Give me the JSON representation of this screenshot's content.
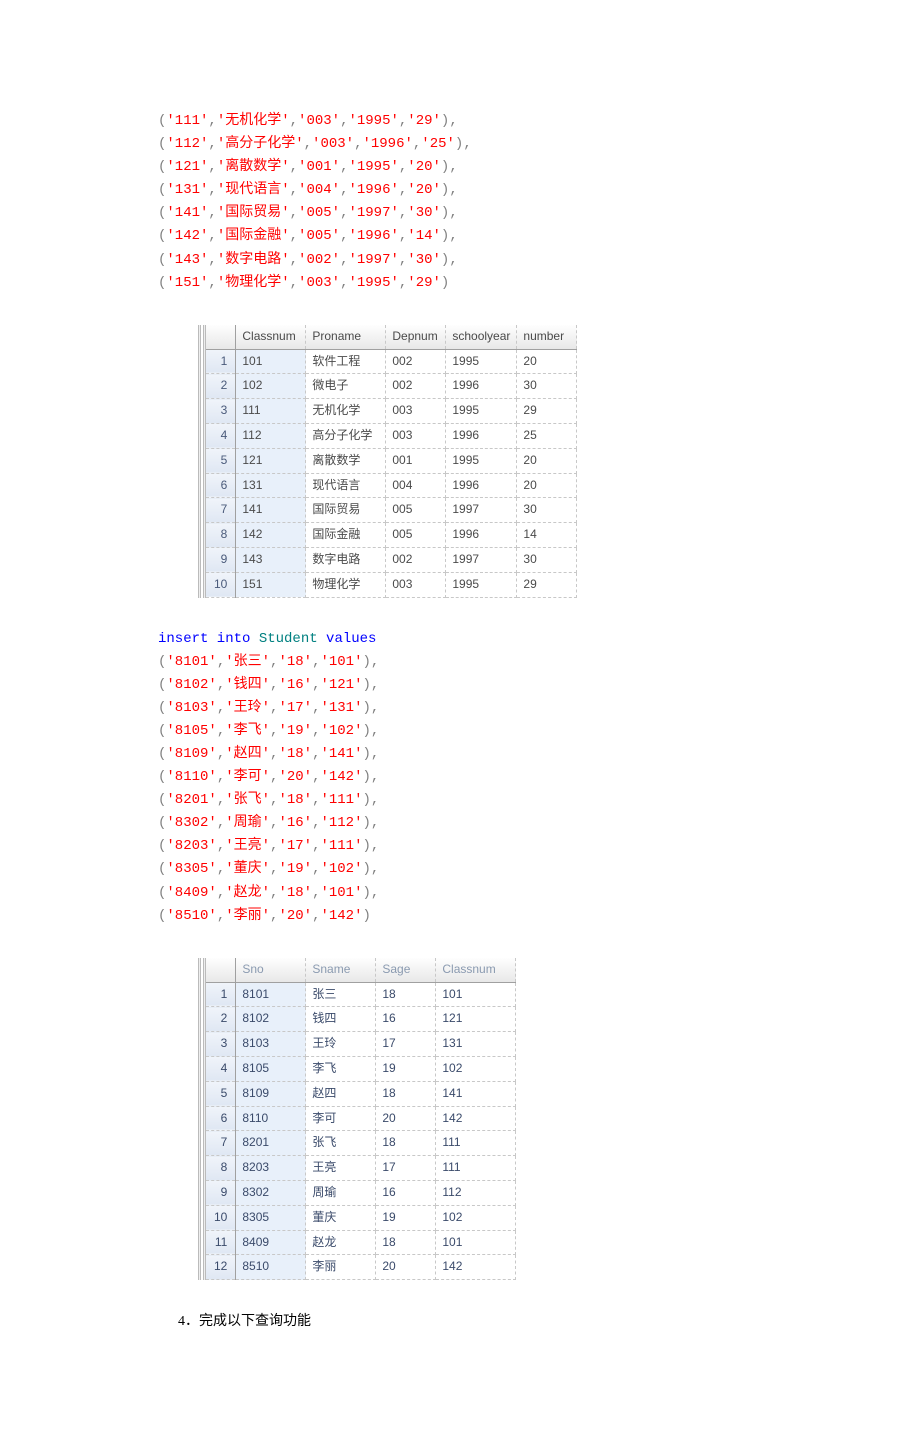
{
  "sql1": [
    {
      "a": "'111'",
      "b": "'无机化学'",
      "c": "'003'",
      "d": "'1995'",
      "e": "'29'",
      "end": ","
    },
    {
      "a": "'112'",
      "b": "'高分子化学'",
      "c": "'003'",
      "d": "'1996'",
      "e": "'25'",
      "end": ","
    },
    {
      "a": "'121'",
      "b": "'离散数学'",
      "c": "'001'",
      "d": "'1995'",
      "e": "'20'",
      "end": ","
    },
    {
      "a": "'131'",
      "b": "'现代语言'",
      "c": "'004'",
      "d": "'1996'",
      "e": "'20'",
      "end": ","
    },
    {
      "a": "'141'",
      "b": "'国际贸易'",
      "c": "'005'",
      "d": "'1997'",
      "e": "'30'",
      "end": ","
    },
    {
      "a": "'142'",
      "b": "'国际金融'",
      "c": "'005'",
      "d": "'1996'",
      "e": "'14'",
      "end": ","
    },
    {
      "a": "'143'",
      "b": "'数字电路'",
      "c": "'002'",
      "d": "'1997'",
      "e": "'30'",
      "end": ","
    },
    {
      "a": "'151'",
      "b": "'物理化学'",
      "c": "'003'",
      "d": "'1995'",
      "e": "'29'",
      "end": ""
    }
  ],
  "table1": {
    "headers": [
      "",
      "Classnum",
      "Proname",
      "Depnum",
      "schoolyear",
      "number"
    ],
    "rows": [
      [
        "1",
        "101",
        "软件工程",
        "002",
        "1995",
        "20"
      ],
      [
        "2",
        "102",
        "微电子",
        "002",
        "1996",
        "30"
      ],
      [
        "3",
        "111",
        "无机化学",
        "003",
        "1995",
        "29"
      ],
      [
        "4",
        "112",
        "高分子化学",
        "003",
        "1996",
        "25"
      ],
      [
        "5",
        "121",
        "离散数学",
        "001",
        "1995",
        "20"
      ],
      [
        "6",
        "131",
        "现代语言",
        "004",
        "1996",
        "20"
      ],
      [
        "7",
        "141",
        "国际贸易",
        "005",
        "1997",
        "30"
      ],
      [
        "8",
        "142",
        "国际金融",
        "005",
        "1996",
        "14"
      ],
      [
        "9",
        "143",
        "数字电路",
        "002",
        "1997",
        "30"
      ],
      [
        "10",
        "151",
        "物理化学",
        "003",
        "1995",
        "29"
      ]
    ]
  },
  "sql2_header": {
    "insert": "insert into",
    "tbl": "Student",
    "values": "values"
  },
  "sql2": [
    {
      "a": "'8101'",
      "b": "'张三'",
      "c": "'18'",
      "d": "'101'",
      "end": ","
    },
    {
      "a": "'8102'",
      "b": "'钱四'",
      "c": "'16'",
      "d": "'121'",
      "end": ","
    },
    {
      "a": "'8103'",
      "b": "'王玲'",
      "c": "'17'",
      "d": "'131'",
      "end": ","
    },
    {
      "a": "'8105'",
      "b": "'李飞'",
      "c": "'19'",
      "d": "'102'",
      "end": ","
    },
    {
      "a": "'8109'",
      "b": "'赵四'",
      "c": "'18'",
      "d": "'141'",
      "end": ","
    },
    {
      "a": "'8110'",
      "b": "'李可'",
      "c": "'20'",
      "d": "'142'",
      "end": ","
    },
    {
      "a": "'8201'",
      "b": "'张飞'",
      "c": "'18'",
      "d": "'111'",
      "end": ","
    },
    {
      "a": "'8302'",
      "b": "'周瑜'",
      "c": "'16'",
      "d": "'112'",
      "end": ","
    },
    {
      "a": "'8203'",
      "b": "'王亮'",
      "c": "'17'",
      "d": "'111'",
      "end": ","
    },
    {
      "a": "'8305'",
      "b": "'董庆'",
      "c": "'19'",
      "d": "'102'",
      "end": ","
    },
    {
      "a": "'8409'",
      "b": "'赵龙'",
      "c": "'18'",
      "d": "'101'",
      "end": ","
    },
    {
      "a": "'8510'",
      "b": "'李丽'",
      "c": "'20'",
      "d": "'142'",
      "end": ""
    }
  ],
  "table2": {
    "headers": [
      "",
      "Sno",
      "Sname",
      "Sage",
      "Classnum"
    ],
    "rows": [
      [
        "1",
        "8101",
        "张三",
        "18",
        "101"
      ],
      [
        "2",
        "8102",
        "钱四",
        "16",
        "121"
      ],
      [
        "3",
        "8103",
        "王玲",
        "17",
        "131"
      ],
      [
        "4",
        "8105",
        "李飞",
        "19",
        "102"
      ],
      [
        "5",
        "8109",
        "赵四",
        "18",
        "141"
      ],
      [
        "6",
        "8110",
        "李可",
        "20",
        "142"
      ],
      [
        "7",
        "8201",
        "张飞",
        "18",
        "111"
      ],
      [
        "8",
        "8203",
        "王亮",
        "17",
        "111"
      ],
      [
        "9",
        "8302",
        "周瑜",
        "16",
        "112"
      ],
      [
        "10",
        "8305",
        "董庆",
        "19",
        "102"
      ],
      [
        "11",
        "8409",
        "赵龙",
        "18",
        "101"
      ],
      [
        "12",
        "8510",
        "李丽",
        "20",
        "142"
      ]
    ]
  },
  "footer": "4．完成以下查询功能"
}
